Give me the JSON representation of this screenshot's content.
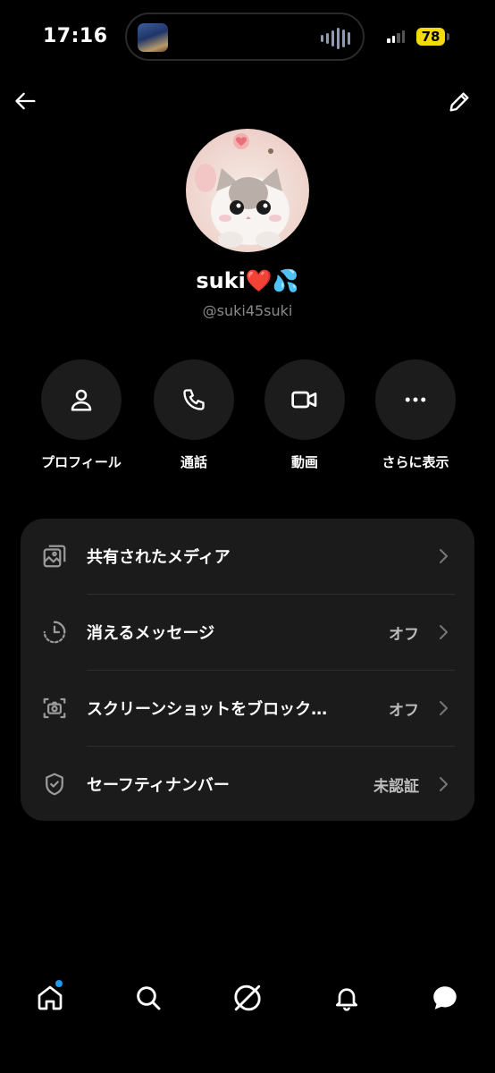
{
  "status_bar": {
    "time": "17:16",
    "battery": "78",
    "battery_color": "#f5d90a"
  },
  "header": {
    "back_icon": "arrow-left-icon",
    "edit_icon": "pencil-icon"
  },
  "profile": {
    "display_name": "suki❤️💦",
    "handle": "@suki45suki",
    "avatar_description_icon": "cat-avatar"
  },
  "actions": [
    {
      "label": "プロフィール",
      "icon": "person-icon"
    },
    {
      "label": "通話",
      "icon": "phone-icon"
    },
    {
      "label": "動画",
      "icon": "video-camera-icon"
    },
    {
      "label": "さらに表示",
      "icon": "more-dots-icon"
    }
  ],
  "settings": [
    {
      "label": "共有されたメディア",
      "value": "",
      "icon": "media-stack-icon"
    },
    {
      "label": "消えるメッセージ",
      "value": "オフ",
      "icon": "timer-icon"
    },
    {
      "label": "スクリーンショットをブロック…",
      "value": "オフ",
      "icon": "screenshot-camera-icon"
    },
    {
      "label": "セーフティナンバー",
      "value": "未認証",
      "icon": "shield-check-icon"
    }
  ],
  "bottom_nav": {
    "items": [
      "home-icon",
      "search-icon",
      "grok-icon",
      "bell-icon",
      "messages-icon"
    ],
    "notification_dot_color": "#1d9bf0"
  }
}
